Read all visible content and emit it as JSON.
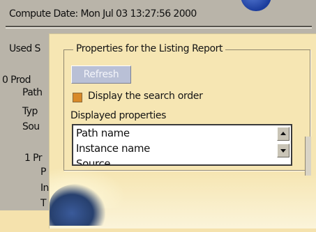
{
  "report": {
    "compute_line": "Compute Date: Mon Jul 03 13:27:56 2000",
    "used_line": "Used S",
    "product_0": {
      "heading": "0 Prod",
      "path": "Path",
      "type": "Typ",
      "source": "Sou"
    },
    "product_1": {
      "heading": "1 Pr",
      "p": "P",
      "i": "In",
      "t": "T"
    },
    "right_glyph": "I"
  },
  "panel": {
    "group_title": "Properties for the Listing Report",
    "refresh_label": "Refresh",
    "display_order_label": "Display the search order",
    "displayed_properties_label": "Displayed properties",
    "list_items": [
      "Path name",
      "Instance name",
      "Source"
    ]
  }
}
